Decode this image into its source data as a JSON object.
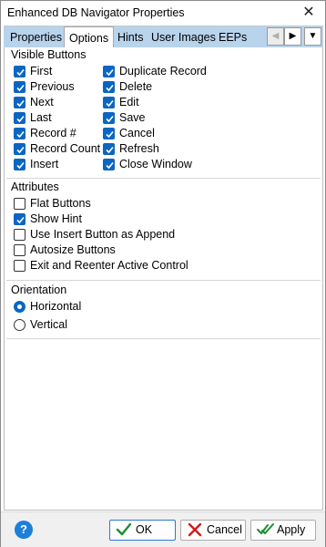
{
  "window": {
    "title": "Enhanced DB Navigator Properties",
    "close_icon": "close-icon"
  },
  "tabs": [
    {
      "label": "Properties",
      "active": false
    },
    {
      "label": "Options",
      "active": true
    },
    {
      "label": "Hints",
      "active": false
    },
    {
      "label": "User Images",
      "active": false
    },
    {
      "label": "EEPs",
      "active": false
    }
  ],
  "visible_buttons": {
    "title": "Visible Buttons",
    "left": [
      {
        "label": "First",
        "checked": true
      },
      {
        "label": "Previous",
        "checked": true
      },
      {
        "label": "Next",
        "checked": true
      },
      {
        "label": "Last",
        "checked": true
      },
      {
        "label": "Record #",
        "checked": true
      },
      {
        "label": "Record Count",
        "checked": true
      },
      {
        "label": "Insert",
        "checked": true
      }
    ],
    "right": [
      {
        "label": "Duplicate Record",
        "checked": true
      },
      {
        "label": "Delete",
        "checked": true
      },
      {
        "label": "Edit",
        "checked": true
      },
      {
        "label": "Save",
        "checked": true
      },
      {
        "label": "Cancel",
        "checked": true
      },
      {
        "label": "Refresh",
        "checked": true
      },
      {
        "label": "Close Window",
        "checked": true
      }
    ]
  },
  "attributes": {
    "title": "Attributes",
    "items": [
      {
        "label": "Flat Buttons",
        "checked": false
      },
      {
        "label": "Show Hint",
        "checked": true
      },
      {
        "label": "Use Insert Button as Append",
        "checked": false
      },
      {
        "label": "Autosize Buttons",
        "checked": false
      },
      {
        "label": "Exit and Reenter Active Control",
        "checked": false
      }
    ]
  },
  "orientation": {
    "title": "Orientation",
    "options": [
      {
        "label": "Horizontal",
        "selected": true
      },
      {
        "label": "Vertical",
        "selected": false
      }
    ]
  },
  "footer": {
    "help_label": "?",
    "ok_label": "OK",
    "cancel_label": "Cancel",
    "apply_label": "Apply"
  },
  "colors": {
    "accent": "#0a66c2",
    "tabstrip": "#b8d3ec",
    "ok_check": "#1a8f2e",
    "cancel_x": "#d01c1c"
  }
}
